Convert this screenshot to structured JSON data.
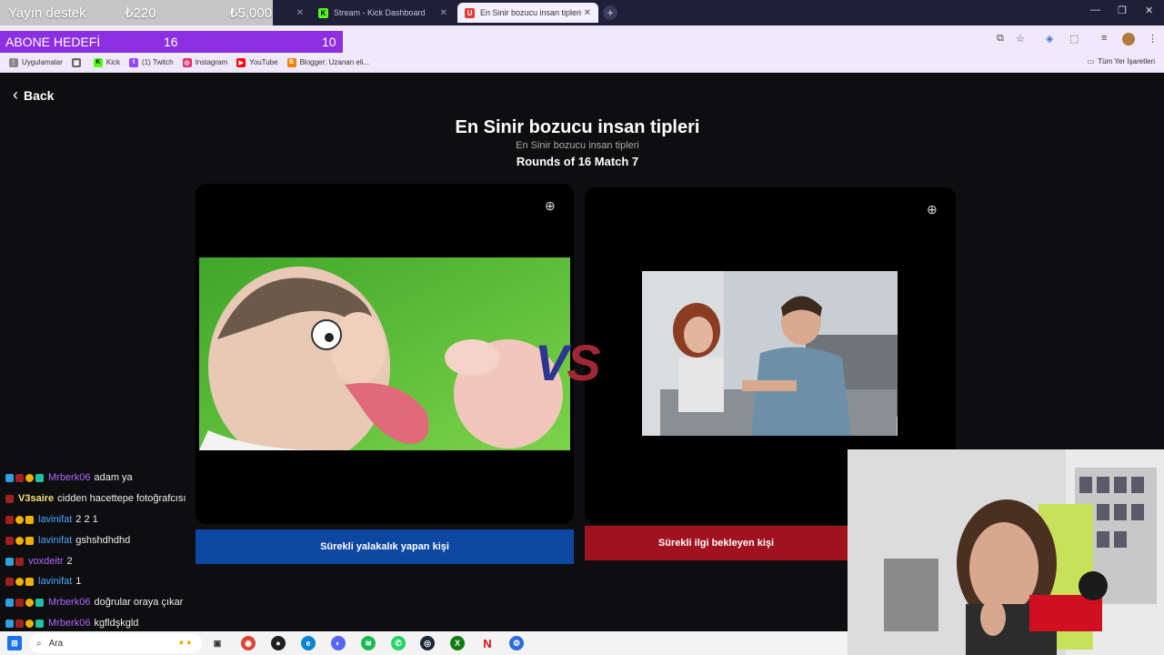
{
  "stream_overlay": {
    "donation_label": "Yayın destek",
    "donation_current": "₺220",
    "donation_goal": "₺5,000",
    "sub_goal_label": "ABONE HEDEFİ",
    "sub_goal_current": "16",
    "sub_goal_target": "10"
  },
  "browser": {
    "tabs": [
      {
        "label": "Stream - Kick Dashboard",
        "active": false
      },
      {
        "label": "En Sinir bozucu insan tipleri | U",
        "active": true
      }
    ],
    "bookmarks": [
      {
        "label": "Uygulamalar",
        "icon": "apps-icon",
        "color": "#888888"
      },
      {
        "label": "Kick",
        "icon": "kick-icon",
        "color": "#53fc18"
      },
      {
        "label": "(1) Twitch",
        "icon": "twitch-icon",
        "color": "#9146ff"
      },
      {
        "label": "Instagram",
        "icon": "instagram-icon",
        "color": "#e1306c"
      },
      {
        "label": "YouTube",
        "icon": "youtube-icon",
        "color": "#ff0000"
      },
      {
        "label": "Blogger: Uzanan eli...",
        "icon": "blogger-icon",
        "color": "#f57d00"
      }
    ],
    "all_bookmarks": "Tüm Yer İşaretleri"
  },
  "page": {
    "back_label": "Back",
    "title": "En Sinir bozucu insan tipleri",
    "subtitle": "En Sinir bozucu insan tipleri",
    "round": "Rounds of 16 Match 7",
    "vs_v": "V",
    "vs_s": "S",
    "left_choice": "Sürekli yalakalık yapan kişi",
    "right_choice": "Sürekli ilgi bekleyen kişi",
    "left_color": "#0d47a1",
    "right_color": "#a0121e"
  },
  "chat": [
    {
      "user": "Mrberk06",
      "text": "adam ya",
      "color": "#b366ff"
    },
    {
      "user": "V3saire",
      "text": "cidden hacettepe fotoğrafcısı",
      "color": "#f4e07a"
    },
    {
      "user": "lavinifat",
      "text": "2 2 1",
      "color": "#4ea3ff"
    },
    {
      "user": "lavinifat",
      "text": "gshshdhdhd",
      "color": "#4ea3ff"
    },
    {
      "user": "voxdeitr",
      "text": "2",
      "color": "#b366ff"
    },
    {
      "user": "lavinifat",
      "text": "1",
      "color": "#4ea3ff"
    },
    {
      "user": "Mrberk06",
      "text": "doğrular oraya çıkar",
      "color": "#b366ff"
    },
    {
      "user": "Mrberk06",
      "text": "kgfldşkgld",
      "color": "#b366ff"
    }
  ],
  "taskbar": {
    "search_placeholder": "Ara"
  }
}
